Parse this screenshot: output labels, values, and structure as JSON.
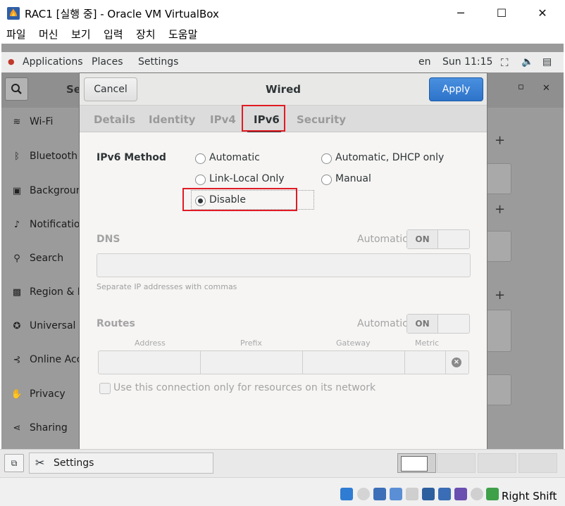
{
  "window": {
    "title": "RAC1 [실행 중] - Oracle VM VirtualBox",
    "minimize": "─",
    "maximize": "☐",
    "close": "✕"
  },
  "menubar": {
    "items": [
      "파일",
      "머신",
      "보기",
      "입력",
      "장치",
      "도움말"
    ]
  },
  "gnome_topbar": {
    "applications": "Applications",
    "places": "Places",
    "settings": "Settings",
    "lang": "en",
    "clock": "Sun 11:15"
  },
  "settings_sidebar": {
    "header_fragment": "Se",
    "items": [
      {
        "label": "Wi-Fi",
        "icon": "wifi-icon"
      },
      {
        "label": "Bluetooth",
        "icon": "bluetooth-icon"
      },
      {
        "label": "Backgroun",
        "icon": "background-icon"
      },
      {
        "label": "Notification",
        "icon": "bell-icon"
      },
      {
        "label": "Search",
        "icon": "search-icon"
      },
      {
        "label": "Region & L",
        "icon": "region-icon"
      },
      {
        "label": "Universal A",
        "icon": "accessibility-icon"
      },
      {
        "label": "Online Acc",
        "icon": "online-accounts-icon"
      },
      {
        "label": "Privacy",
        "icon": "privacy-icon"
      },
      {
        "label": "Sharing",
        "icon": "share-icon"
      }
    ],
    "right_panel_close": "✕",
    "right_panel_restore": "▫"
  },
  "dialog": {
    "cancel": "Cancel",
    "title": "Wired",
    "apply": "Apply",
    "tabs": [
      "Details",
      "Identity",
      "IPv4",
      "IPv6",
      "Security"
    ],
    "active_tab": "IPv6",
    "ipv6_method_label": "IPv6 Method",
    "methods": {
      "automatic": "Automatic",
      "automatic_dhcp": "Automatic, DHCP only",
      "link_local": "Link-Local Only",
      "manual": "Manual",
      "disable": "Disable"
    },
    "selected_method": "Disable",
    "dns": {
      "label": "DNS",
      "auto_label": "Automatic",
      "switch": "ON",
      "value": "",
      "hint": "Separate IP addresses with commas"
    },
    "routes": {
      "label": "Routes",
      "auto_label": "Automatic",
      "switch": "ON",
      "columns": [
        "Address",
        "Prefix",
        "Gateway",
        "Metric"
      ]
    },
    "only_local_checkbox": "Use this connection only for resources on its network"
  },
  "taskbar": {
    "settings_task": "Settings"
  },
  "vbox_status": {
    "host_key": "Right Shift"
  }
}
